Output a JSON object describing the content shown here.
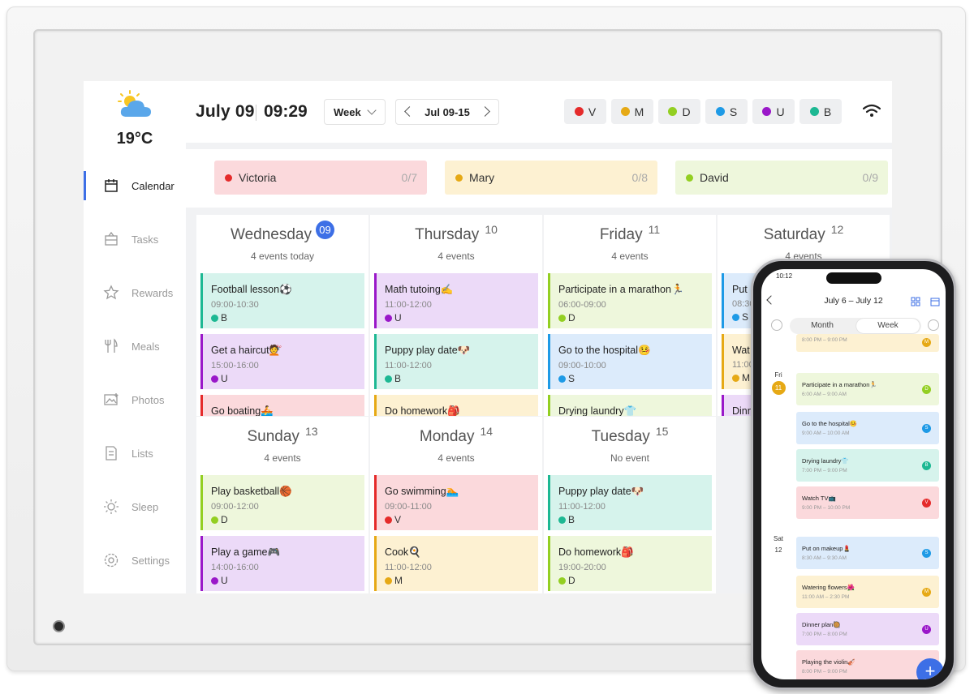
{
  "header": {
    "date": "July 09",
    "time": "09:29",
    "view": "Week",
    "range": "Jul 09-15"
  },
  "weather": {
    "temp": "19°C"
  },
  "members": [
    {
      "letter": "V",
      "color": "#e52b2b"
    },
    {
      "letter": "M",
      "color": "#e6a915"
    },
    {
      "letter": "D",
      "color": "#93cf22"
    },
    {
      "letter": "S",
      "color": "#1e9ae6"
    },
    {
      "letter": "U",
      "color": "#9a18c9"
    },
    {
      "letter": "B",
      "color": "#1db893"
    }
  ],
  "sidebar": {
    "items": [
      {
        "label": "Calendar",
        "active": true
      },
      {
        "label": "Tasks"
      },
      {
        "label": "Rewards"
      },
      {
        "label": "Meals"
      },
      {
        "label": "Photos"
      },
      {
        "label": "Lists"
      },
      {
        "label": "Sleep"
      },
      {
        "label": "Settings"
      }
    ]
  },
  "people": [
    {
      "name": "Victoria",
      "count": "0/7",
      "bg": "#fbd9dc",
      "dot": "#e52b2b"
    },
    {
      "name": "Mary",
      "count": "0/8",
      "bg": "#fdf1d2",
      "dot": "#e6a915"
    },
    {
      "name": "David",
      "count": "0/9",
      "bg": "#eef7dc",
      "dot": "#93cf22"
    }
  ],
  "days": [
    {
      "name": "Wednesday",
      "num": "09",
      "today": true,
      "count": "4 events today",
      "events": [
        {
          "title": "Football lesson⚽",
          "time": "09:00-10:30",
          "who": "B"
        },
        {
          "title": "Get a haircut💇",
          "time": "15:00-16:00",
          "who": "U"
        },
        {
          "title": "Go boating🚣",
          "time": "",
          "who": ""
        }
      ]
    },
    {
      "name": "Thursday",
      "num": "10",
      "count": "4 events",
      "events": [
        {
          "title": "Math tutoing✍",
          "time": "11:00-12:00",
          "who": "U"
        },
        {
          "title": "Puppy play date🐶",
          "time": "11:00-12:00",
          "who": "B"
        },
        {
          "title": "Do homework🎒",
          "time": "",
          "who": ""
        }
      ]
    },
    {
      "name": "Friday",
      "num": "11",
      "count": "4 events",
      "events": [
        {
          "title": "Participate in a marathon🏃",
          "time": "06:00-09:00",
          "who": "D"
        },
        {
          "title": "Go to the hospital🤒",
          "time": "09:00-10:00",
          "who": "S"
        },
        {
          "title": "Drying laundry👕",
          "time": "",
          "who": ""
        }
      ]
    },
    {
      "name": "Saturday",
      "num": "12",
      "count": "4 events",
      "events": [
        {
          "title": "Put",
          "time": "08:30",
          "who": "S"
        },
        {
          "title": "Wat",
          "time": "11:00",
          "who": "M"
        },
        {
          "title": "Dinn",
          "time": "",
          "who": ""
        }
      ]
    },
    {
      "name": "Sunday",
      "num": "13",
      "count": "4 events",
      "events": [
        {
          "title": "Play basketball🏀",
          "time": "09:00-12:00",
          "who": "D"
        },
        {
          "title": "Play a game🎮",
          "time": "14:00-16:00",
          "who": "U"
        }
      ]
    },
    {
      "name": "Monday",
      "num": "14",
      "count": "4 events",
      "events": [
        {
          "title": "Go swimming🏊",
          "time": "09:00-11:00",
          "who": "V"
        },
        {
          "title": "Cook🍳",
          "time": "11:00-12:00",
          "who": "M"
        }
      ]
    },
    {
      "name": "Tuesday",
      "num": "15",
      "count": "No event",
      "events": [
        {
          "title": "Puppy play date🐶",
          "time": "11:00-12:00",
          "who": "B"
        },
        {
          "title": "Do homework🎒",
          "time": "19:00-20:00",
          "who": "D"
        }
      ]
    }
  ],
  "phone": {
    "status_time": "10:12",
    "range": "July 6 – July 12",
    "seg_month": "Month",
    "seg_week": "Week",
    "fri_label": "Fri",
    "fri_num": "11",
    "sat_label": "Sat",
    "sat_num": "12",
    "events": [
      {
        "title": "",
        "time": "8:00 PM – 9:00 PM",
        "who": "M"
      },
      {
        "title": "Participate in a marathon🏃",
        "time": "6:00 AM – 9:00 AM",
        "who": "D"
      },
      {
        "title": "Go to the hospital🤒",
        "time": "9:00 AM – 10:00 AM",
        "who": "S"
      },
      {
        "title": "Drying laundry👕",
        "time": "7:00 PM – 9:00 PM",
        "who": "B"
      },
      {
        "title": "Watch TV📺",
        "time": "9:00 PM – 10:00 PM",
        "who": "V"
      },
      {
        "title": "Put on makeup💄",
        "time": "8:30 AM – 9:30 AM",
        "who": "S"
      },
      {
        "title": "Watering flowers🌺",
        "time": "11:00 AM – 2:30 PM",
        "who": "M"
      },
      {
        "title": "Dinner plan🥘",
        "time": "7:00 PM – 8:00 PM",
        "who": "U"
      },
      {
        "title": "Playing the violin🎻",
        "time": "8:00 PM – 9:00 PM",
        "who": "V"
      }
    ],
    "fab": "+"
  },
  "colors": {
    "V": {
      "bg": "#fbd9dc",
      "bar": "#e52b2b",
      "dot": "#e52b2b"
    },
    "M": {
      "bg": "#fdf1d2",
      "bar": "#e6a915",
      "dot": "#e6a915"
    },
    "D": {
      "bg": "#eef7dc",
      "bar": "#93cf22",
      "dot": "#93cf22"
    },
    "S": {
      "bg": "#dcebfb",
      "bar": "#1e9ae6",
      "dot": "#1e9ae6"
    },
    "U": {
      "bg": "#ecdaf8",
      "bar": "#9a18c9",
      "dot": "#9a18c9"
    },
    "B": {
      "bg": "#d6f3ec",
      "bar": "#1db893",
      "dot": "#1db893"
    }
  },
  "icons": [
    "partly-cloudy-icon",
    "calendar-icon",
    "tasks-icon",
    "rewards-icon",
    "meals-icon",
    "photos-icon",
    "lists-icon",
    "sleep-icon",
    "settings-icon",
    "wifi-icon"
  ]
}
